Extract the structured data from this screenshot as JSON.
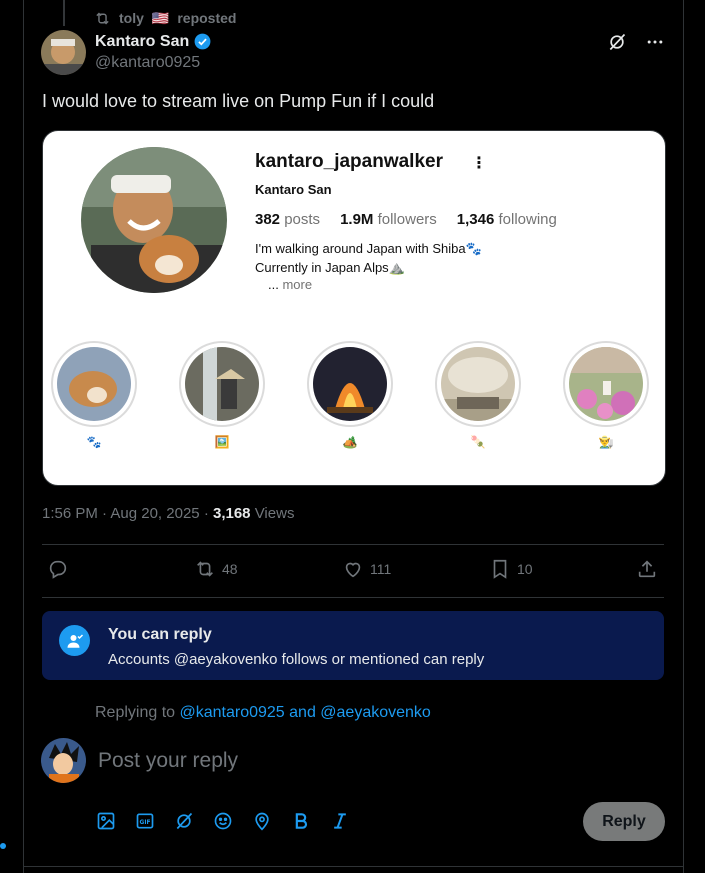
{
  "repost": {
    "text": "toly",
    "flag": "🇺🇸",
    "suffix": "reposted"
  },
  "author": {
    "name": "Kantaro San",
    "handle": "@kantaro0925",
    "verified": true
  },
  "tweet": {
    "text": "I would love to stream live on Pump Fun if I could"
  },
  "media": {
    "username": "kantaro_japanwalker",
    "display_name": "Kantaro San",
    "posts": "382",
    "posts_label": "posts",
    "followers": "1.9M",
    "followers_label": "followers",
    "following": "1,346",
    "following_label": "following",
    "bio_line1": "I'm walking around Japan with Shiba🐾",
    "bio_line2": "Currently in Japan Alps⛰️",
    "more_prefix": "...",
    "more": "more",
    "highlights": [
      "🐾",
      "🖼️",
      "🏕️",
      "🍡",
      "👨‍🌾"
    ]
  },
  "meta": {
    "time": "1:56 PM",
    "sep": "·",
    "date": "Aug 20, 2025",
    "views": "3,168",
    "views_label": "Views"
  },
  "actions": {
    "reposts": "48",
    "likes": "111",
    "bookmarks": "10"
  },
  "can_reply": {
    "title": "You can reply",
    "text": "Accounts @aeyakovenko follows or mentioned can reply"
  },
  "replying": {
    "prefix": "Replying to",
    "users": "@kantaro0925 and @aeyakovenko"
  },
  "composer": {
    "placeholder": "Post your reply",
    "button": "Reply"
  },
  "colors": {
    "accent": "#1d9bf0",
    "background": "#000000",
    "muted": "#71767b",
    "notice_bg": "#0a1a4e"
  }
}
